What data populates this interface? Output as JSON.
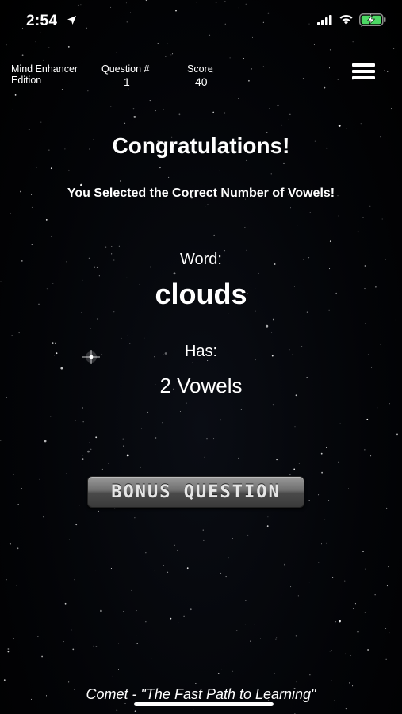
{
  "status_bar": {
    "time": "2:54",
    "icons": [
      "location-arrow-icon",
      "signal-icon",
      "wifi-icon",
      "battery-charging-icon"
    ]
  },
  "header": {
    "edition": "Mind Enhancer Edition",
    "question_label": "Question #",
    "question_number": "1",
    "score_label": "Score",
    "score_value": "40",
    "menu_icon": "hamburger-menu-icon"
  },
  "result": {
    "title": "Congratulations!",
    "message": "You Selected the Correct Number of Vowels!",
    "word_label": "Word:",
    "word": "clouds",
    "has_label": "Has:",
    "vowel_count_text": "2 Vowels"
  },
  "bonus_button_label": "BONUS QUESTION",
  "footer_text": "Comet - \"The Fast Path to Learning\"",
  "colors": {
    "background": "#000000",
    "text": "#ffffff",
    "button": "#6e6e6e",
    "battery": "#4cd964"
  }
}
